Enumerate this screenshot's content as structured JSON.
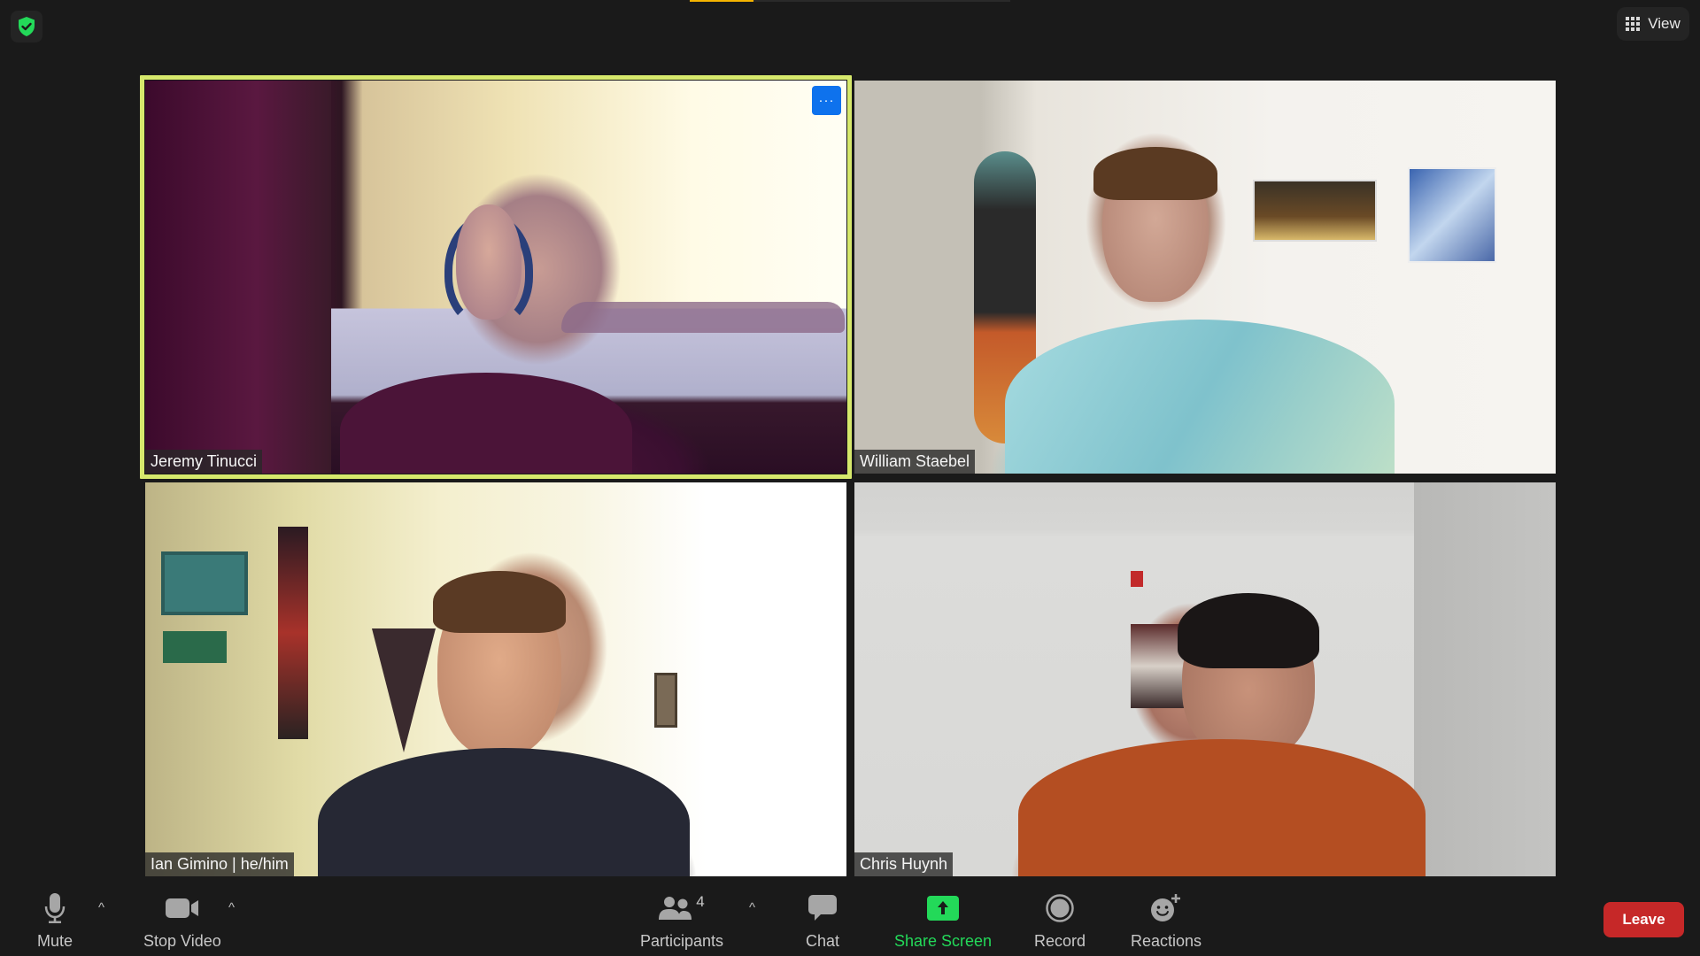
{
  "top": {
    "security_icon": "shield-check-icon",
    "view_label": "View",
    "view_icon": "grid-icon",
    "colors": {
      "security": "#23d959",
      "top_indicator": "#f5b400"
    }
  },
  "participants": [
    {
      "name": "Jeremy Tinucci",
      "active_speaker": true,
      "more_label": "···"
    },
    {
      "name": "William Staebel",
      "active_speaker": false
    },
    {
      "name": "Ian Gimino | he/him",
      "active_speaker": false
    },
    {
      "name": "Chris Huynh",
      "active_speaker": false
    }
  ],
  "toolbar": {
    "mute": {
      "label": "Mute",
      "icon": "microphone-icon"
    },
    "video": {
      "label": "Stop Video",
      "icon": "video-camera-icon"
    },
    "participants": {
      "label": "Participants",
      "count": "4",
      "icon": "participants-icon"
    },
    "chat": {
      "label": "Chat",
      "icon": "chat-bubble-icon"
    },
    "share": {
      "label": "Share Screen",
      "icon": "share-screen-icon",
      "color": "#23d959"
    },
    "record": {
      "label": "Record",
      "icon": "record-icon"
    },
    "reactions": {
      "label": "Reactions",
      "icon": "reactions-icon"
    },
    "caret": "^",
    "leave_label": "Leave",
    "leave_color": "#c62828"
  }
}
